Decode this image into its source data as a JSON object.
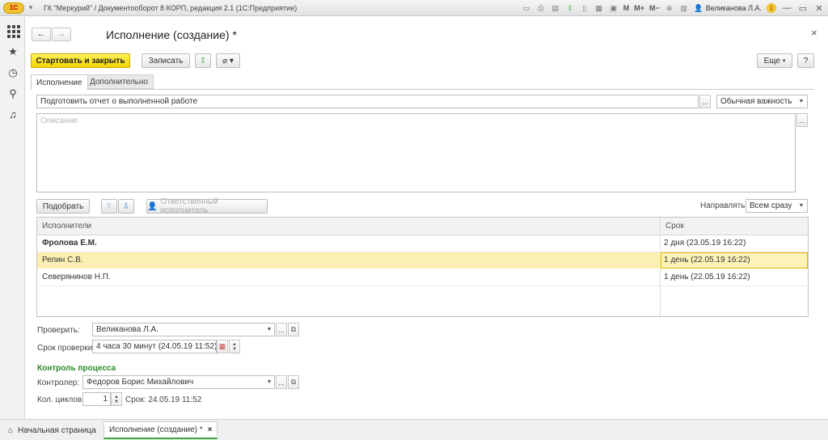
{
  "app": {
    "logo_text": "1С",
    "title": "ГК \"Меркурий\" / Документооборот 8 КОРП, редакция 2.1  (1С:Предприятие)",
    "toolbar_m": "M",
    "toolbar_mplus": "M+",
    "toolbar_mminus": "M−",
    "user": "Великанова Л.А."
  },
  "form": {
    "title": "Исполнение (создание) *",
    "start_close_label": "Стартовать и закрыть",
    "save_label": "Записать",
    "more_label": "Еще",
    "help_label": "?",
    "tabs": [
      "Исполнение",
      "Дополнительно"
    ],
    "subject_value": "Подготовить отчет о выполненной работе",
    "importance_value": "Обычная важность",
    "description_placeholder": "Описание",
    "pick_label": "Подобрать",
    "responsible_label": "Ответственный исполнитель",
    "send_label": "Направлять:",
    "send_value": "Всем сразу"
  },
  "table": {
    "columns": [
      "Исполнители",
      "Срок"
    ],
    "rows": [
      {
        "name": "Фролова Е.М.",
        "term": "2 дня (23.05.19 16:22)"
      },
      {
        "name": "Репин С.В.",
        "term": "1 день (22.05.19 16:22)"
      },
      {
        "name": "Северянинов Н.П.",
        "term": "1 день (22.05.19 16:22)"
      }
    ]
  },
  "check": {
    "label": "Проверить:",
    "value": "Великанова Л.А.",
    "term_label": "Срок проверки:",
    "term_value": "4 часа 30 минут (24.05.19 11:52)"
  },
  "process": {
    "section_title": "Контроль процесса",
    "controller_label": "Контролер:",
    "controller_value": "Федоров Борис Михайлович",
    "cycles_label": "Кол. циклов:",
    "cycles_value": "1",
    "term_text": "Срок:  24.05.19 11:52"
  },
  "taskbar": {
    "home_label": "Начальная страница",
    "current_label": "Исполнение (создание) *"
  }
}
